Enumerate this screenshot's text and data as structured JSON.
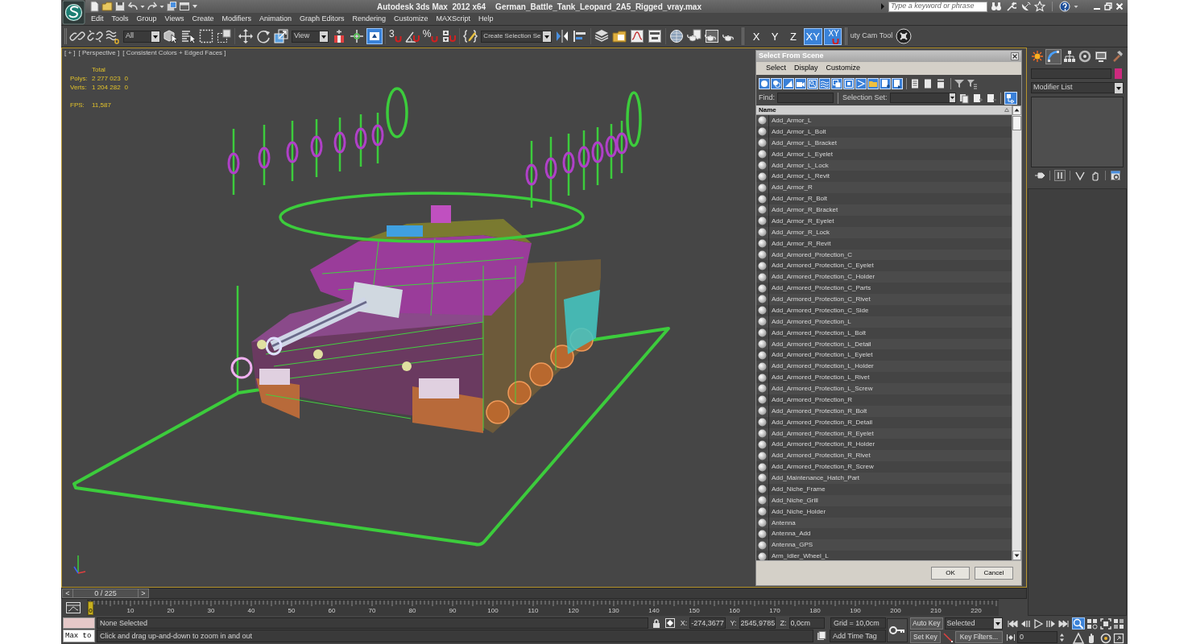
{
  "title_bar": {
    "app_title": "Autodesk 3ds Max  2012 x64",
    "file_name": "German_Battle_Tank_Leopard_2A5_Rigged_vray.max",
    "search": {
      "placeholder": "Type a keyword or phrase"
    }
  },
  "menu_bar": [
    "Edit",
    "Tools",
    "Group",
    "Views",
    "Create",
    "Modifiers",
    "Animation",
    "Graph Editors",
    "Rendering",
    "Customize",
    "MAXScript",
    "Help"
  ],
  "main_toolbar": {
    "selection_filter": "All",
    "reference_coordinate_system": "View",
    "keyboard_override": {
      "on": true
    },
    "snap_toggles": [
      "3",
      "%"
    ],
    "named_selection_set": "Create Selection Se",
    "axis_constraints": [
      {
        "label": "X",
        "selected": false
      },
      {
        "label": "Y",
        "selected": false
      },
      {
        "label": "Z",
        "selected": false
      },
      {
        "label": "XY",
        "selected": true
      }
    ],
    "axis_snap": {
      "label": "XY",
      "on": true
    },
    "extra_toolbar": "uty Cam Tool"
  },
  "viewport": {
    "labels": [
      "[ + ]",
      "[ Perspective ]",
      "[ Consistent Colors + Edged Faces ]"
    ],
    "stats": {
      "heading": "Total",
      "rows": [
        {
          "label": "Polys:",
          "total": "2 277 023",
          "column_2": "0"
        },
        {
          "label": "Verts:",
          "total": "1 204 282",
          "column_2": "0"
        }
      ],
      "fps_label": "FPS:",
      "fps": "11,587"
    }
  },
  "select_from_scene": {
    "title": "Select From Scene",
    "menu": [
      "Select",
      "Display",
      "Customize"
    ],
    "type_filters": [
      {
        "on": true
      },
      {
        "on": true
      },
      {
        "on": true
      },
      {
        "on": true
      },
      {
        "on": true
      },
      {
        "on": true
      },
      {
        "on": true
      },
      {
        "on": true
      },
      {
        "on": true
      },
      {
        "on": true
      },
      {
        "on": true
      },
      {
        "on": true
      }
    ],
    "display_toggles": [
      {
        "on": false
      },
      {
        "on": false
      },
      {
        "on": false
      }
    ],
    "find_label": "Find:",
    "selection_set_label": "Selection Set:",
    "sync_toggle": {
      "on": true
    },
    "column": "Name",
    "items": [
      {
        "name": "Add_Armor_L",
        "selected": false
      },
      {
        "name": "Add_Armor_L_Bolt",
        "selected": false
      },
      {
        "name": "Add_Armor_L_Bracket",
        "selected": false
      },
      {
        "name": "Add_Armor_L_Eyelet",
        "selected": false
      },
      {
        "name": "Add_Armor_L_Lock",
        "selected": false
      },
      {
        "name": "Add_Armor_L_Revit",
        "selected": false
      },
      {
        "name": "Add_Armor_R",
        "selected": false
      },
      {
        "name": "Add_Armor_R_Bolt",
        "selected": false
      },
      {
        "name": "Add_Armor_R_Bracket",
        "selected": false
      },
      {
        "name": "Add_Armor_R_Eyelet",
        "selected": false
      },
      {
        "name": "Add_Armor_R_Lock",
        "selected": false
      },
      {
        "name": "Add_Armor_R_Revit",
        "selected": false
      },
      {
        "name": "Add_Armored_Protection_C",
        "selected": false
      },
      {
        "name": "Add_Armored_Protection_C_Eyelet",
        "selected": false
      },
      {
        "name": "Add_Armored_Protection_C_Holder",
        "selected": false
      },
      {
        "name": "Add_Armored_Protection_C_Parts",
        "selected": false
      },
      {
        "name": "Add_Armored_Protection_C_Rivet",
        "selected": false
      },
      {
        "name": "Add_Armored_Protection_C_Side",
        "selected": false
      },
      {
        "name": "Add_Armored_Protection_L",
        "selected": false
      },
      {
        "name": "Add_Armored_Protection_L_Bolt",
        "selected": false
      },
      {
        "name": "Add_Armored_Protection_L_Detail",
        "selected": false
      },
      {
        "name": "Add_Armored_Protection_L_Eyelet",
        "selected": false
      },
      {
        "name": "Add_Armored_Protection_L_Holder",
        "selected": false
      },
      {
        "name": "Add_Armored_Protection_L_Rivet",
        "selected": false
      },
      {
        "name": "Add_Armored_Protection_L_Screw",
        "selected": false
      },
      {
        "name": "Add_Armored_Protection_R",
        "selected": false
      },
      {
        "name": "Add_Armored_Protection_R_Bolt",
        "selected": false
      },
      {
        "name": "Add_Armored_Protection_R_Detail",
        "selected": false
      },
      {
        "name": "Add_Armored_Protection_R_Eyelet",
        "selected": false
      },
      {
        "name": "Add_Armored_Protection_R_Holder",
        "selected": false
      },
      {
        "name": "Add_Armored_Protection_R_Rivet",
        "selected": false
      },
      {
        "name": "Add_Armored_Protection_R_Screw",
        "selected": false
      },
      {
        "name": "Add_Maintenance_Hatch_Part",
        "selected": false
      },
      {
        "name": "Add_Niche_Frame",
        "selected": false
      },
      {
        "name": "Add_Niche_Grill",
        "selected": false
      },
      {
        "name": "Add_Niche_Holder",
        "selected": false
      },
      {
        "name": "Antenna",
        "selected": false
      },
      {
        "name": "Antenna_Add",
        "selected": false
      },
      {
        "name": "Antenna_GPS",
        "selected": false
      },
      {
        "name": "Arm_Idler_Wheel_L",
        "selected": false
      }
    ],
    "buttons": [
      "OK",
      "Cancel"
    ]
  },
  "command_panel": {
    "tabs": [
      {
        "selected": false
      },
      {
        "selected": true
      },
      {
        "selected": false
      },
      {
        "selected": false
      },
      {
        "selected": false
      },
      {
        "selected": false
      }
    ],
    "modifier_list": "Modifier List"
  },
  "time_slider": {
    "prev": "<",
    "label": "0 / 225",
    "next": ">",
    "level": 0
  },
  "track_bar": {
    "current_frame": "0",
    "ticks": [
      "10",
      "20",
      "30",
      "40",
      "50",
      "60",
      "70",
      "80",
      "90",
      "100",
      "110",
      "120",
      "130",
      "140",
      "150",
      "160",
      "170",
      "180",
      "190",
      "200",
      "210",
      "220"
    ]
  },
  "status_bar": {
    "listener_input": "Max to",
    "selection": "None Selected",
    "prompt": "Click and drag up-and-down to zoom in and out",
    "coordinates": [
      {
        "label": "X:",
        "value": "-274,3677"
      },
      {
        "label": "Y:",
        "value": "2545,9785"
      },
      {
        "label": "Z:",
        "value": "0,0cm"
      }
    ],
    "grid": "Grid = 10,0cm",
    "time_tag": "Add Time Tag",
    "auto_key": "Auto Key",
    "key_mode": "Selected",
    "set_key": "Set Key",
    "key_filters": "Key Filters...",
    "frame": "0"
  },
  "navigation_tools": [
    {
      "selected": true
    },
    {
      "selected": false
    },
    {
      "selected": false
    },
    {
      "selected": false
    },
    {
      "selected": false
    },
    {
      "selected": false
    },
    {
      "selected": false
    },
    {
      "selected": false
    }
  ]
}
